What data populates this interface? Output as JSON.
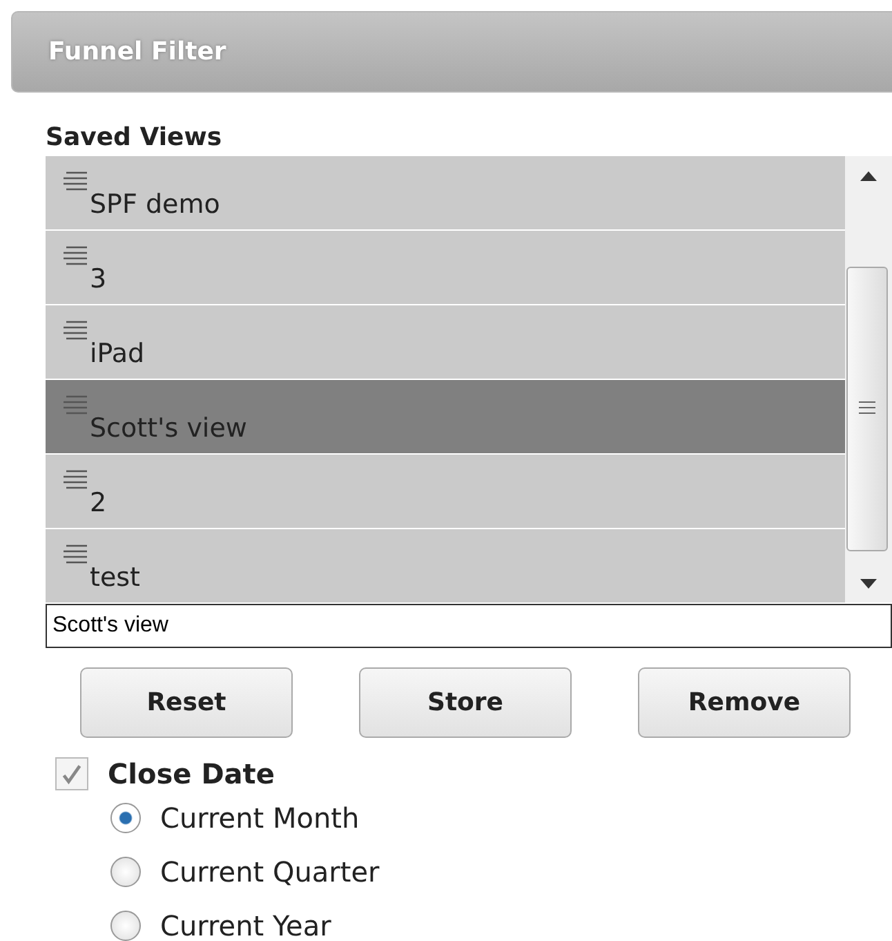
{
  "header": {
    "title": "Funnel Filter"
  },
  "saved_views": {
    "label": "Saved Views",
    "items": [
      {
        "label": "SPF demo",
        "selected": false
      },
      {
        "label": "3",
        "selected": false
      },
      {
        "label": "iPad",
        "selected": false
      },
      {
        "label": "Scott's view",
        "selected": true
      },
      {
        "label": "2",
        "selected": false
      },
      {
        "label": "test",
        "selected": false
      }
    ],
    "name_field": {
      "value": "Scott's view"
    },
    "buttons": [
      "Reset",
      "Store",
      "Remove"
    ]
  },
  "close_date": {
    "label": "Close Date",
    "checked": true,
    "disabled": true,
    "options": [
      {
        "label": "Current Month",
        "selected": true
      },
      {
        "label": "Current Quarter",
        "selected": false
      },
      {
        "label": "Current Year",
        "selected": false
      }
    ]
  }
}
